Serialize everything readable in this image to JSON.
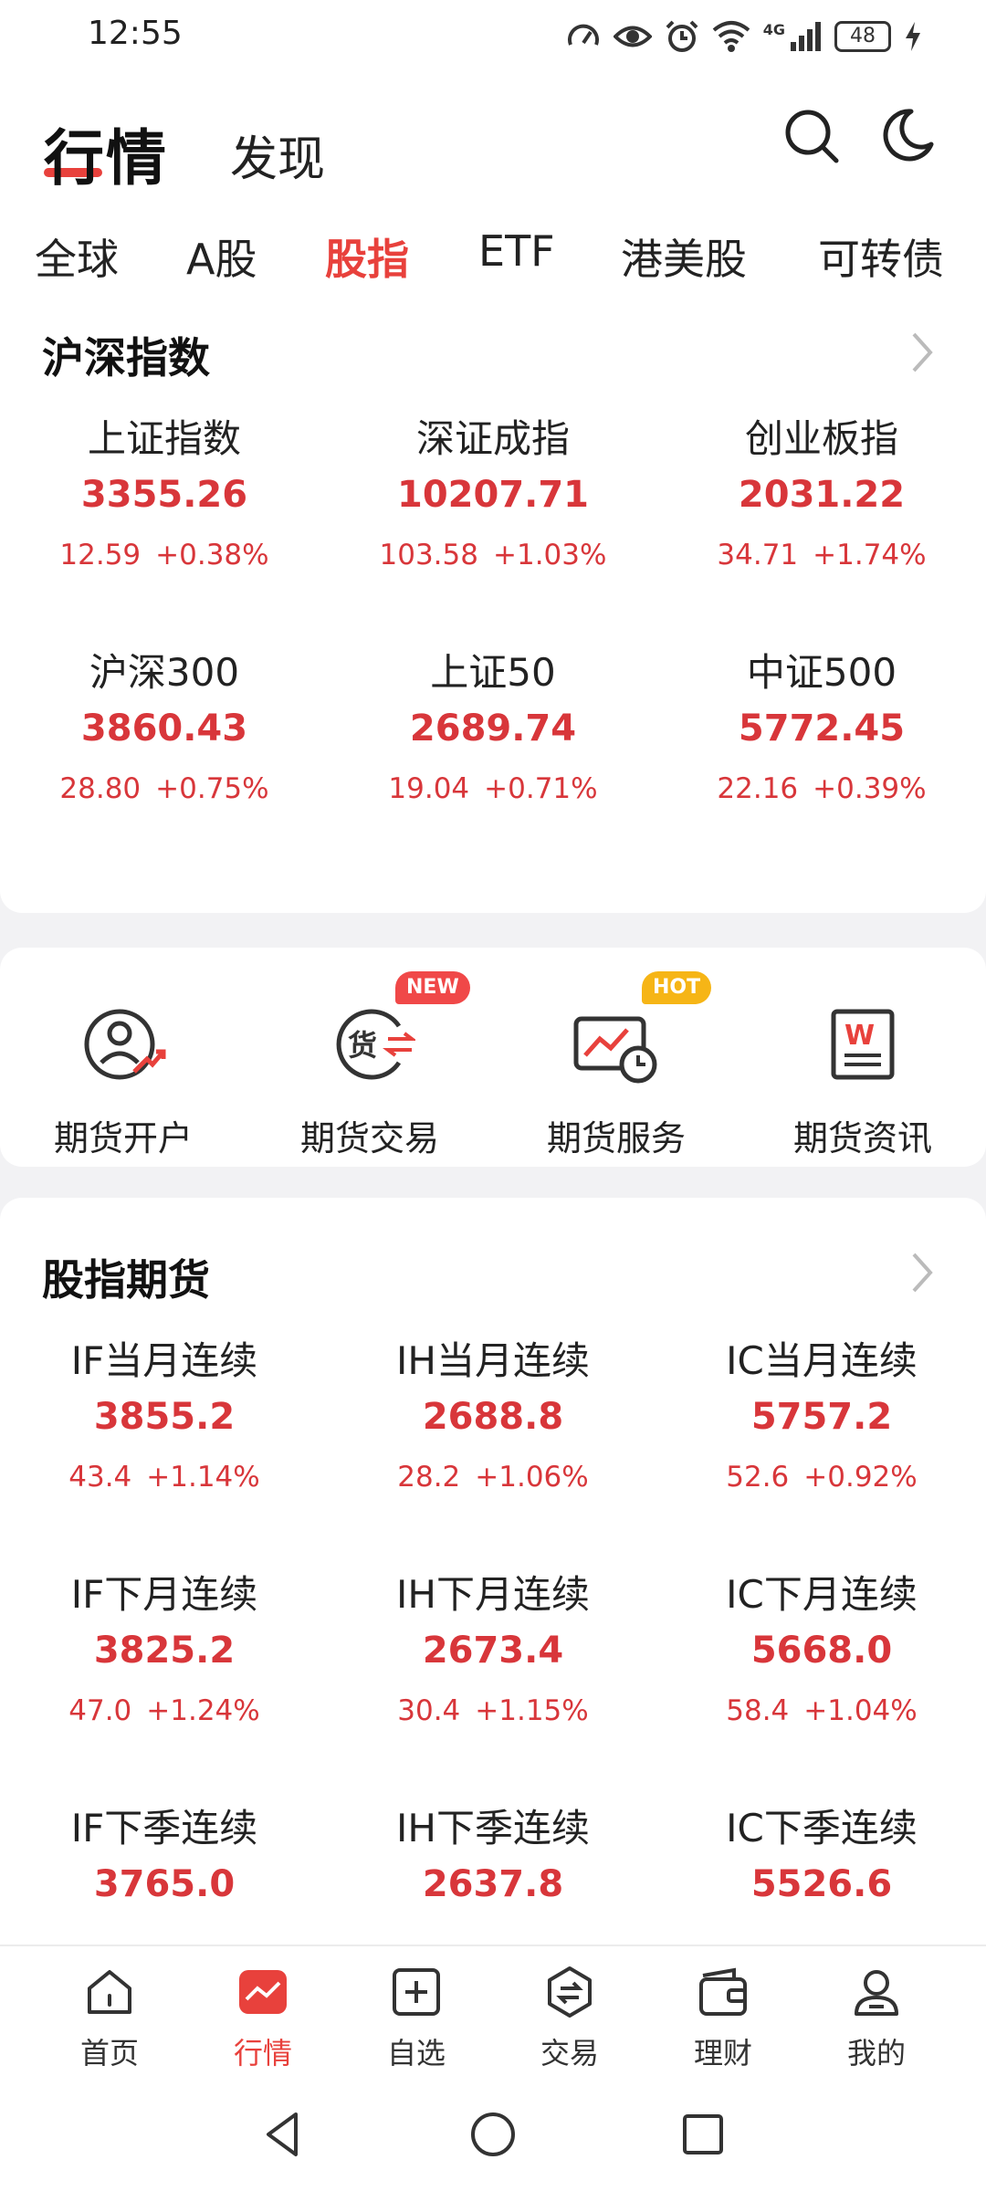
{
  "status_bar": {
    "time": "12:55",
    "network": "4G",
    "battery": "48",
    "icons": [
      "speedometer-icon",
      "eye-icon",
      "alarm-icon",
      "wifi-icon",
      "signal-icon",
      "battery-icon",
      "charging-icon"
    ]
  },
  "header": {
    "title": "行情",
    "subtitle": "发现",
    "icons": [
      "search-icon",
      "moon-icon"
    ]
  },
  "tabs": [
    {
      "label": "全球",
      "active": false
    },
    {
      "label": "A股",
      "active": false
    },
    {
      "label": "股指",
      "active": true
    },
    {
      "label": "ETF",
      "active": false
    },
    {
      "label": "港美股",
      "active": false
    },
    {
      "label": "可转债",
      "active": false
    }
  ],
  "indices_section": {
    "title": "沪深指数",
    "items": [
      {
        "name": "上证指数",
        "value": "3355.26",
        "change": "12.59",
        "pct": "+0.38%"
      },
      {
        "name": "深证成指",
        "value": "10207.71",
        "change": "103.58",
        "pct": "+1.03%"
      },
      {
        "name": "创业板指",
        "value": "2031.22",
        "change": "34.71",
        "pct": "+1.74%"
      },
      {
        "name": "沪深300",
        "value": "3860.43",
        "change": "28.80",
        "pct": "+0.75%"
      },
      {
        "name": "上证50",
        "value": "2689.74",
        "change": "19.04",
        "pct": "+0.71%"
      },
      {
        "name": "中证500",
        "value": "5772.45",
        "change": "22.16",
        "pct": "+0.39%"
      }
    ]
  },
  "services": [
    {
      "label": "期货开户",
      "icon": "account-open-icon",
      "badge": ""
    },
    {
      "label": "期货交易",
      "icon": "futures-trade-icon",
      "badge": "NEW"
    },
    {
      "label": "期货服务",
      "icon": "futures-service-icon",
      "badge": "HOT"
    },
    {
      "label": "期货资讯",
      "icon": "futures-news-icon",
      "badge": ""
    }
  ],
  "futures_section": {
    "title": "股指期货",
    "items": [
      {
        "name": "IF当月连续",
        "value": "3855.2",
        "change": "43.4",
        "pct": "+1.14%"
      },
      {
        "name": "IH当月连续",
        "value": "2688.8",
        "change": "28.2",
        "pct": "+1.06%"
      },
      {
        "name": "IC当月连续",
        "value": "5757.2",
        "change": "52.6",
        "pct": "+0.92%"
      },
      {
        "name": "IF下月连续",
        "value": "3825.2",
        "change": "47.0",
        "pct": "+1.24%"
      },
      {
        "name": "IH下月连续",
        "value": "2673.4",
        "change": "30.4",
        "pct": "+1.15%"
      },
      {
        "name": "IC下月连续",
        "value": "5668.0",
        "change": "58.4",
        "pct": "+1.04%"
      },
      {
        "name": "IF下季连续",
        "value": "3765.0",
        "change": "",
        "pct": ""
      },
      {
        "name": "IH下季连续",
        "value": "2637.8",
        "change": "",
        "pct": ""
      },
      {
        "name": "IC下季连续",
        "value": "5526.6",
        "change": "",
        "pct": ""
      }
    ]
  },
  "bottom_nav": [
    {
      "label": "首页",
      "icon": "home-icon",
      "active": false
    },
    {
      "label": "行情",
      "icon": "market-icon",
      "active": true
    },
    {
      "label": "自选",
      "icon": "watchlist-add-icon",
      "active": false
    },
    {
      "label": "交易",
      "icon": "trade-icon",
      "active": false
    },
    {
      "label": "理财",
      "icon": "wallet-icon",
      "active": false
    },
    {
      "label": "我的",
      "icon": "profile-icon",
      "active": false
    }
  ],
  "colors": {
    "accent": "#e8413c",
    "up": "#d8363a",
    "badge_new": "#f04848",
    "badge_hot": "#f6b516"
  }
}
